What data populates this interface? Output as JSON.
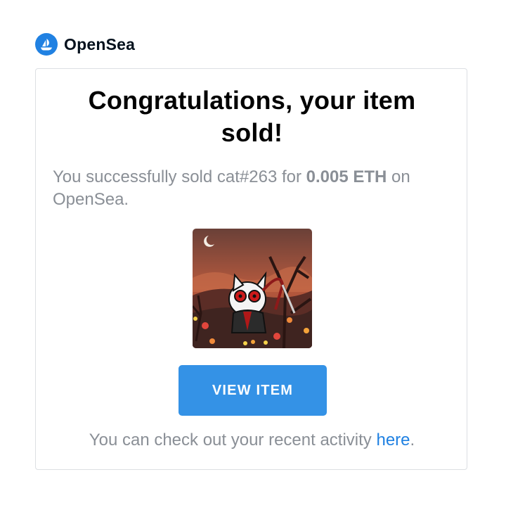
{
  "brand": {
    "name": "OpenSea",
    "logo_icon": "opensea-sailboat-icon",
    "accent_color": "#2081E2"
  },
  "card": {
    "title": "Congratulations, your item sold!",
    "message": {
      "prefix": "You successfully sold cat#263 for ",
      "amount": "0.005 ETH",
      "suffix": " on OpenSea."
    },
    "image": {
      "name": "cat-nft-image",
      "alt": "cat#263"
    },
    "button_label": "VIEW ITEM",
    "button_color": "#3492E6",
    "footer": {
      "prefix": "You can check out your recent activity ",
      "link_label": "here",
      "suffix": "."
    }
  }
}
